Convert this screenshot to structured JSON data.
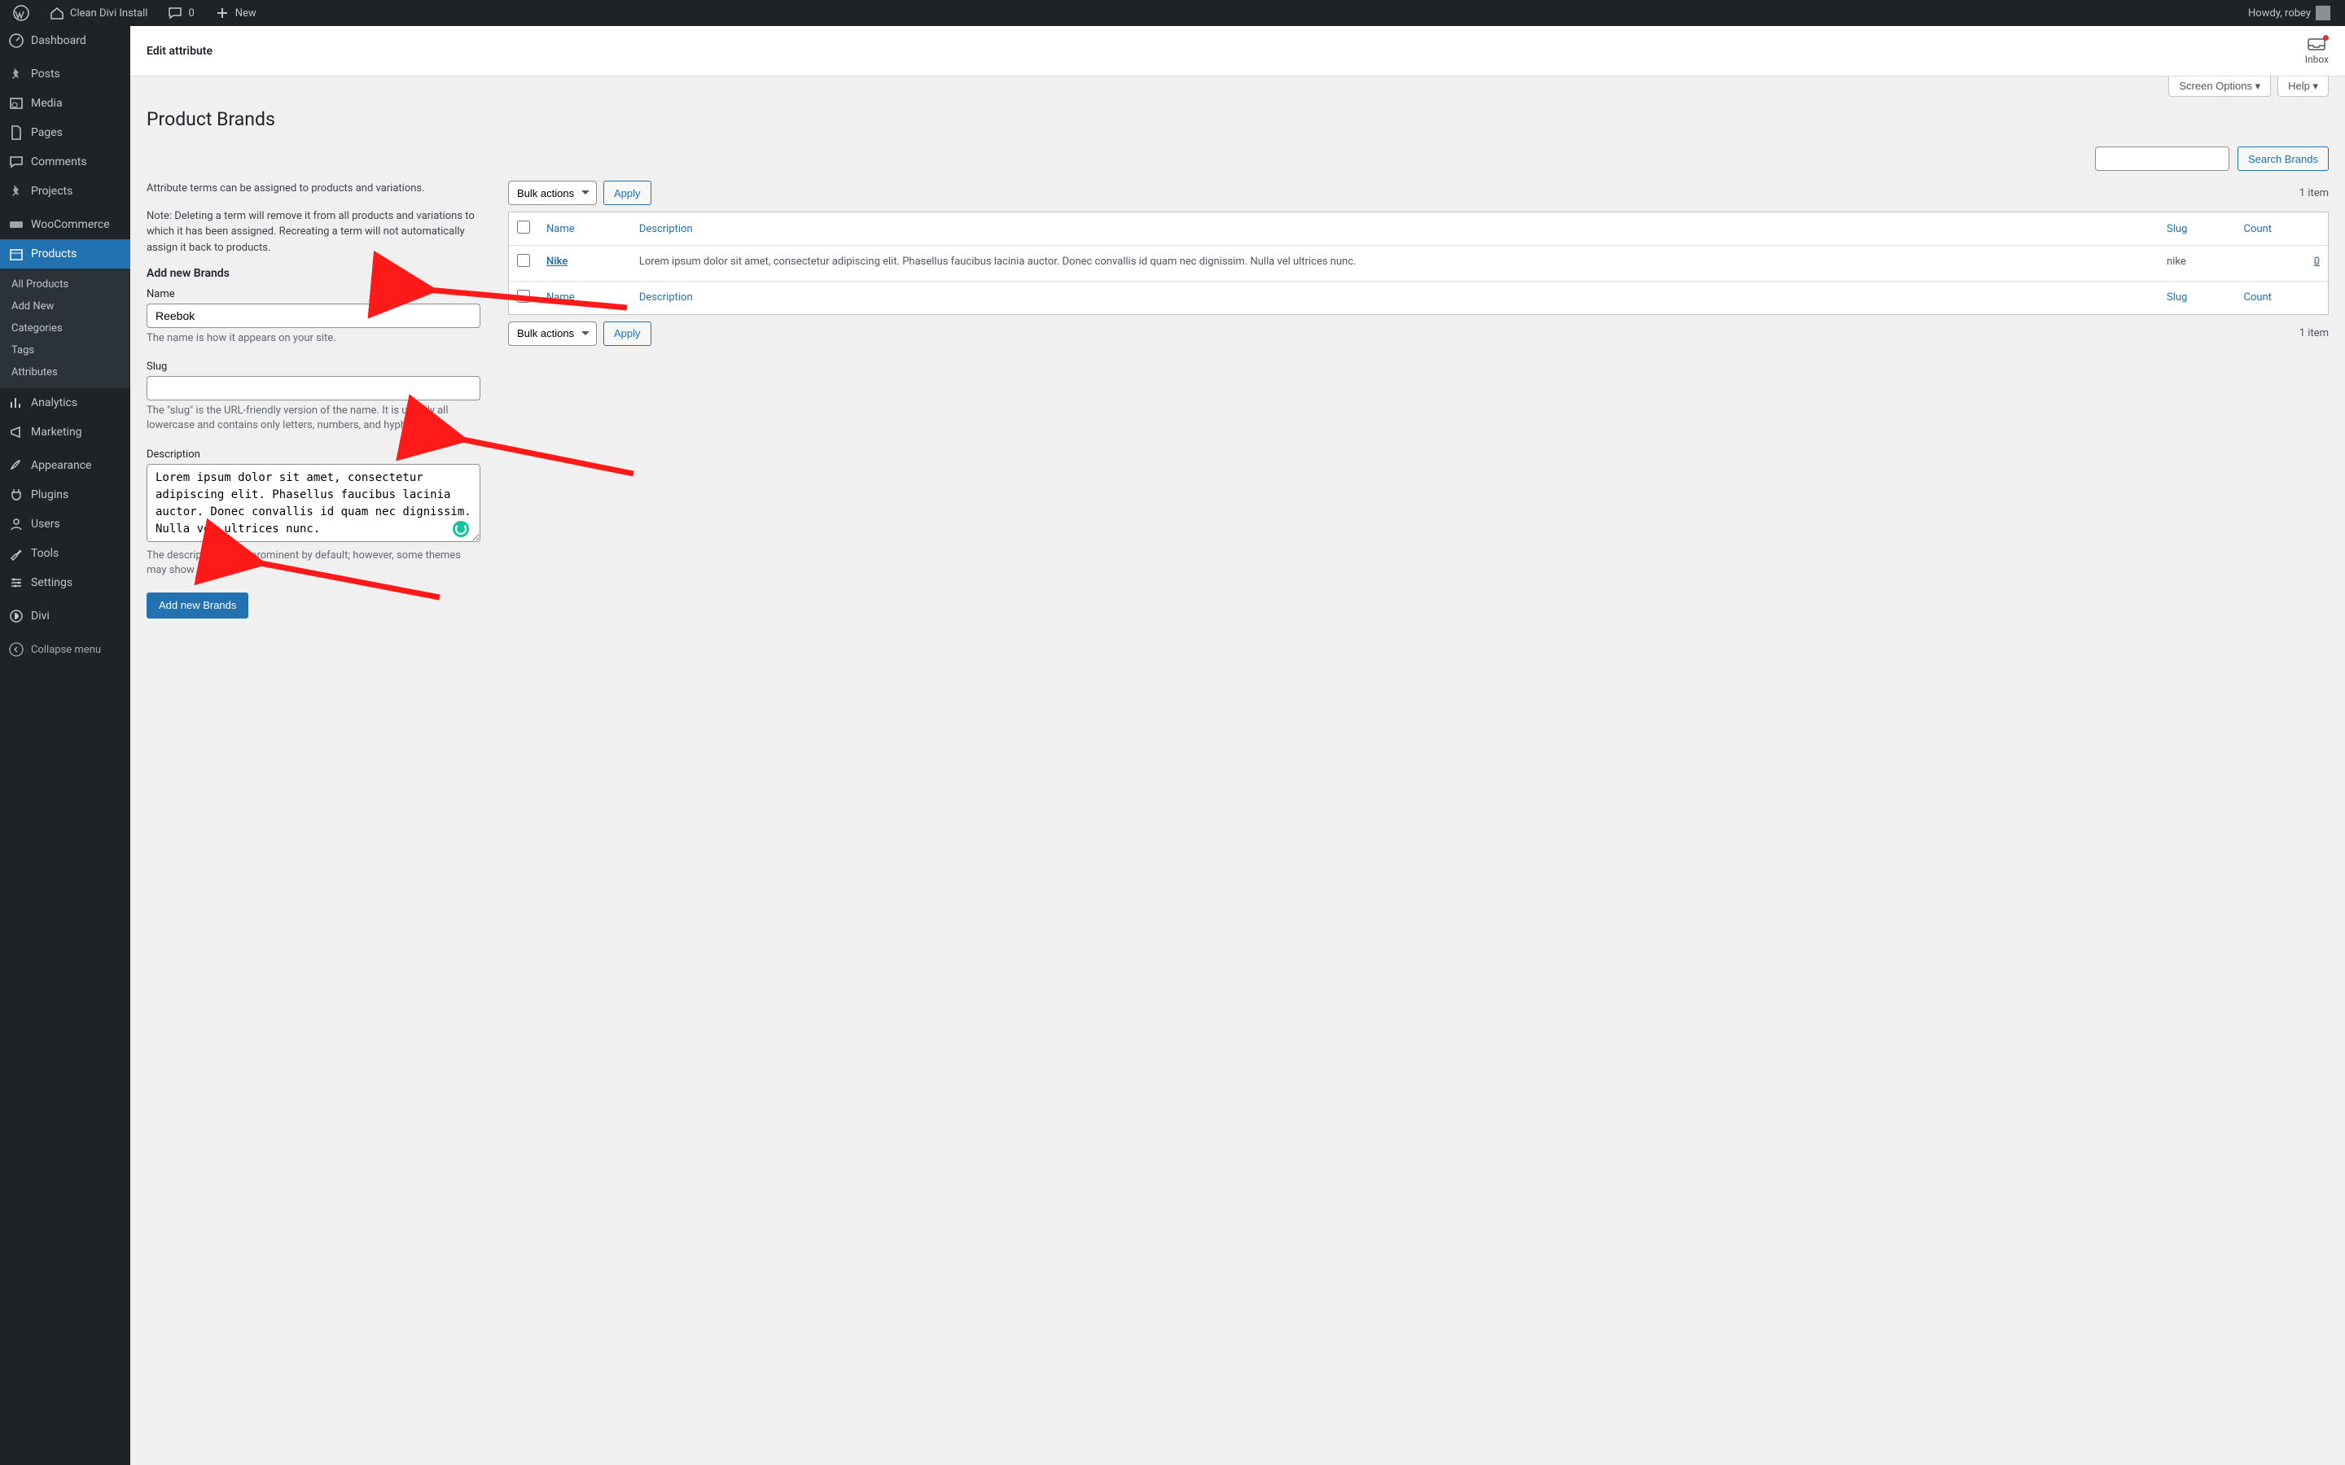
{
  "adminbar": {
    "site_name": "Clean Divi Install",
    "comment_count": "0",
    "new_label": "New",
    "howdy": "Howdy, robey"
  },
  "sidebar": {
    "dashboard": "Dashboard",
    "posts": "Posts",
    "media": "Media",
    "pages": "Pages",
    "comments": "Comments",
    "projects": "Projects",
    "woocommerce": "WooCommerce",
    "products": "Products",
    "sub": {
      "all": "All Products",
      "add": "Add New",
      "categories": "Categories",
      "tags": "Tags",
      "attributes": "Attributes"
    },
    "analytics": "Analytics",
    "marketing": "Marketing",
    "appearance": "Appearance",
    "plugins": "Plugins",
    "users": "Users",
    "tools": "Tools",
    "settings": "Settings",
    "divi": "Divi",
    "collapse": "Collapse menu"
  },
  "topstrip": {
    "title": "Edit attribute",
    "inbox": "Inbox"
  },
  "toprow": {
    "screen_options": "Screen Options ▾",
    "help": "Help ▾"
  },
  "page": {
    "heading": "Product Brands",
    "search_button": "Search Brands",
    "intro1": "Attribute terms can be assigned to products and variations.",
    "intro2": "Note: Deleting a term will remove it from all products and variations to which it has been assigned. Recreating a term will not automatically assign it back to products.",
    "add_heading": "Add new Brands",
    "name_label": "Name",
    "name_value": "Reebok",
    "name_desc": "The name is how it appears on your site.",
    "slug_label": "Slug",
    "slug_value": "",
    "slug_desc": "The \"slug\" is the URL-friendly version of the name. It is usually all lowercase and contains only letters, numbers, and hyphens.",
    "desc_label": "Description",
    "desc_value": "Lorem ipsum dolor sit amet, consectetur adipiscing elit. Phasellus faucibus lacinia auctor. Donec convallis id quam nec dignissim. Nulla vel ultrices nunc.",
    "desc_desc": "The description is not prominent by default; however, some themes may show it.",
    "submit": "Add new Brands"
  },
  "table": {
    "bulk_label": "Bulk actions",
    "apply": "Apply",
    "item_count": "1 item",
    "cols": {
      "name": "Name",
      "description": "Description",
      "slug": "Slug",
      "count": "Count"
    },
    "rows": [
      {
        "name": "Nike",
        "description": "Lorem ipsum dolor sit amet, consectetur adipiscing elit. Phasellus faucibus lacinia auctor. Donec convallis id quam nec dignissim. Nulla vel ultrices nunc.",
        "slug": "nike",
        "count": "0"
      }
    ]
  }
}
